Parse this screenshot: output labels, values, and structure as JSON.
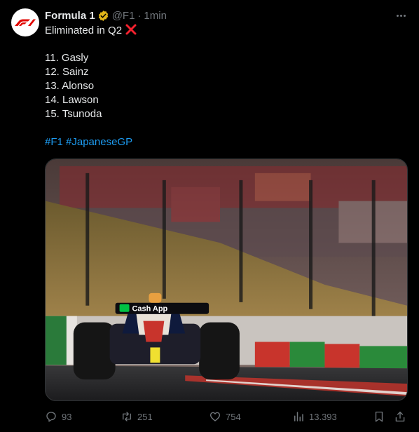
{
  "tweet": {
    "author_name": "Formula 1",
    "handle": "@F1",
    "separator": "·",
    "time": "1min",
    "text_lines": [
      "Eliminated in Q2",
      "",
      "11. Gasly",
      "12. Sainz",
      "13. Alonso",
      "14. Lawson",
      "15. Tsunoda"
    ],
    "hashtags": [
      "#F1",
      "#JapaneseGP"
    ],
    "image_sign": "Cash App"
  },
  "stats": {
    "replies": "93",
    "reposts": "251",
    "likes": "754",
    "views": "13.393"
  },
  "colors": {
    "background": "#000000",
    "link": "#1d9bf0",
    "muted": "#71767b",
    "verified_badge": "#e2b719",
    "x_mark": "#f4212e",
    "f1_red": "#e10600"
  },
  "icons": [
    "f1-logo-icon",
    "verified-badge-icon",
    "more-options-icon",
    "cross-mark-icon",
    "reply-icon",
    "repost-icon",
    "like-icon",
    "views-icon",
    "bookmark-icon",
    "share-icon"
  ]
}
